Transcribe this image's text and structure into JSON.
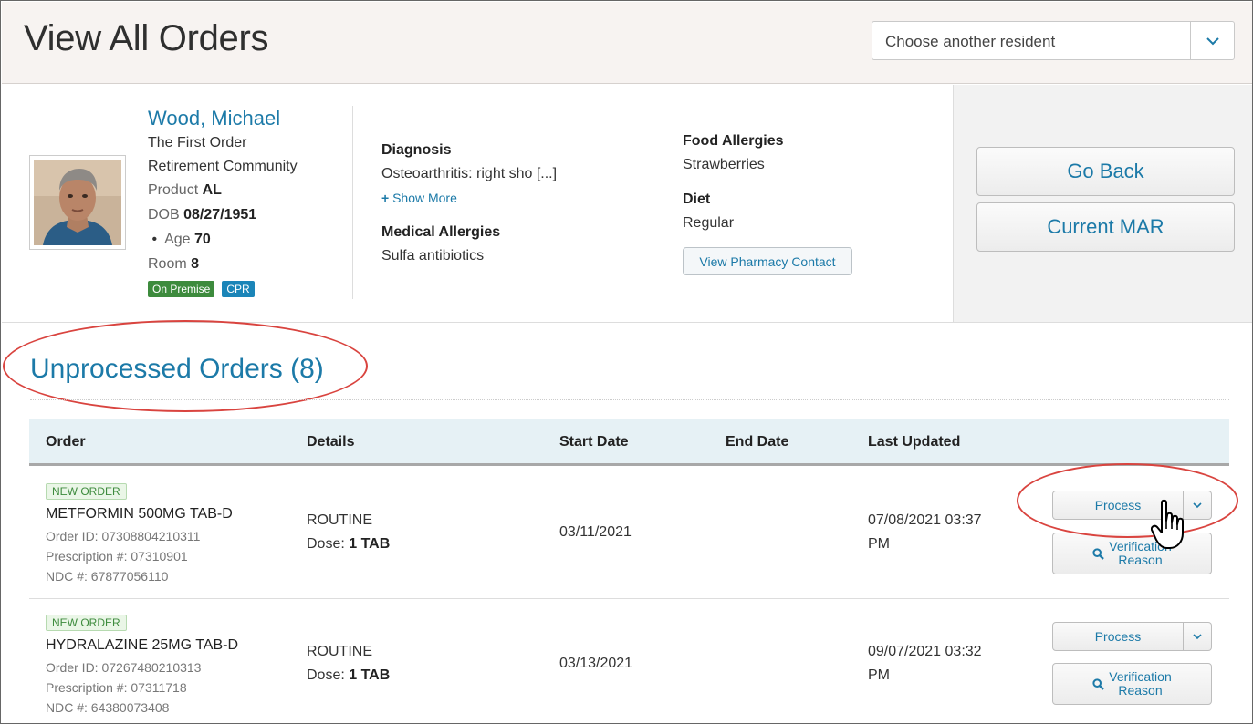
{
  "header": {
    "title": "View All Orders",
    "resident_select_placeholder": "Choose another resident"
  },
  "resident": {
    "name": "Wood, Michael",
    "community_line1": "The First Order",
    "community_line2": "Retirement Community",
    "product_label": "Product",
    "product_value": "AL",
    "dob_label": "DOB",
    "dob_value": "08/27/1951",
    "age_label": "Age",
    "age_value": "70",
    "room_label": "Room",
    "room_value": "8",
    "badges": [
      "On Premise",
      "CPR"
    ],
    "diagnosis_label": "Diagnosis",
    "diagnosis_value": "Osteoarthritis: right sho [...]",
    "show_more": "Show More",
    "medical_allergies_label": "Medical Allergies",
    "medical_allergies_value": "Sulfa antibiotics",
    "food_allergies_label": "Food Allergies",
    "food_allergies_value": "Strawberries",
    "diet_label": "Diet",
    "diet_value": "Regular",
    "pharmacy_button": "View Pharmacy Contact"
  },
  "actions": {
    "go_back": "Go Back",
    "current_mar": "Current MAR"
  },
  "section": {
    "title": "Unprocessed Orders (8)"
  },
  "table": {
    "columns": [
      "Order",
      "Details",
      "Start Date",
      "End Date",
      "Last Updated"
    ],
    "rows": [
      {
        "tag": "NEW ORDER",
        "drug": "METFORMIN 500MG TAB-D",
        "order_id": "Order ID: 07308804210311",
        "prescription": "Prescription #: 07310901",
        "ndc": "NDC #: 67877056110",
        "frequency": "ROUTINE",
        "dose_label": "Dose:",
        "dose_value": "1 TAB",
        "start_date": "03/11/2021",
        "end_date": "",
        "last_updated_line1": "07/08/2021 03:37",
        "last_updated_line2": "PM",
        "process_label": "Process",
        "verify_line1": "Verification",
        "verify_line2": "Reason"
      },
      {
        "tag": "NEW ORDER",
        "drug": "HYDRALAZINE 25MG TAB-D",
        "order_id": "Order ID: 07267480210313",
        "prescription": "Prescription #: 07311718",
        "ndc": "NDC #: 64380073408",
        "frequency": "ROUTINE",
        "dose_label": "Dose:",
        "dose_value": "1 TAB",
        "start_date": "03/13/2021",
        "end_date": "",
        "last_updated_line1": "09/07/2021 03:32",
        "last_updated_line2": "PM",
        "process_label": "Process",
        "verify_line1": "Verification",
        "verify_line2": "Reason"
      }
    ]
  },
  "colors": {
    "link": "#1c7aa8",
    "annotation": "#d9443f",
    "badge_green": "#3d8b3d",
    "badge_blue": "#1b85b8"
  }
}
